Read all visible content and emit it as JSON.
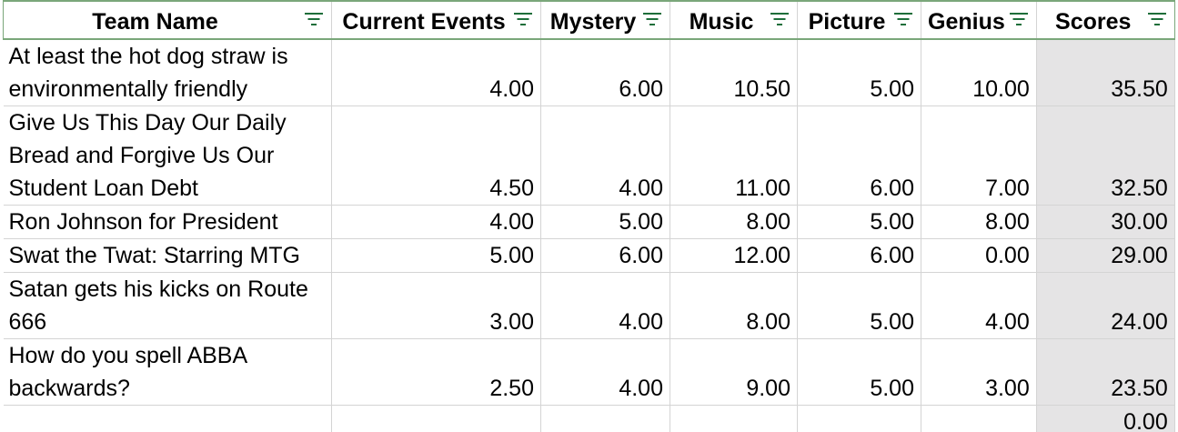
{
  "table": {
    "headers": [
      "Team Name",
      "Current Events",
      "Mystery",
      "Music",
      "Picture",
      "Genius",
      "Scores"
    ],
    "rows": [
      [
        "At least the hot dog straw is environmentally friendly",
        "4.00",
        "6.00",
        "10.50",
        "5.00",
        "10.00",
        "35.50"
      ],
      [
        "Give Us This Day Our Daily Bread and Forgive Us Our Student Loan Debt",
        "4.50",
        "4.00",
        "11.00",
        "6.00",
        "7.00",
        "32.50"
      ],
      [
        "Ron Johnson for President",
        "4.00",
        "5.00",
        "8.00",
        "5.00",
        "8.00",
        "30.00"
      ],
      [
        "Swat the Twat: Starring MTG",
        "5.00",
        "6.00",
        "12.00",
        "6.00",
        "0.00",
        "29.00"
      ],
      [
        "Satan gets his kicks on Route 666",
        "3.00",
        "4.00",
        "8.00",
        "5.00",
        "4.00",
        "24.00"
      ],
      [
        "How do you spell ABBA backwards?",
        "2.50",
        "4.00",
        "9.00",
        "5.00",
        "3.00",
        "23.50"
      ],
      [
        "",
        "",
        "",
        "",
        "",
        "",
        "0.00"
      ]
    ]
  },
  "colors": {
    "header_border": "#7aa77a",
    "filter_icon": "#1e6e3a",
    "scores_shade": "#e5e4e5",
    "gridline": "#d4d4d4"
  },
  "icons": {
    "filter": "filter-icon"
  }
}
